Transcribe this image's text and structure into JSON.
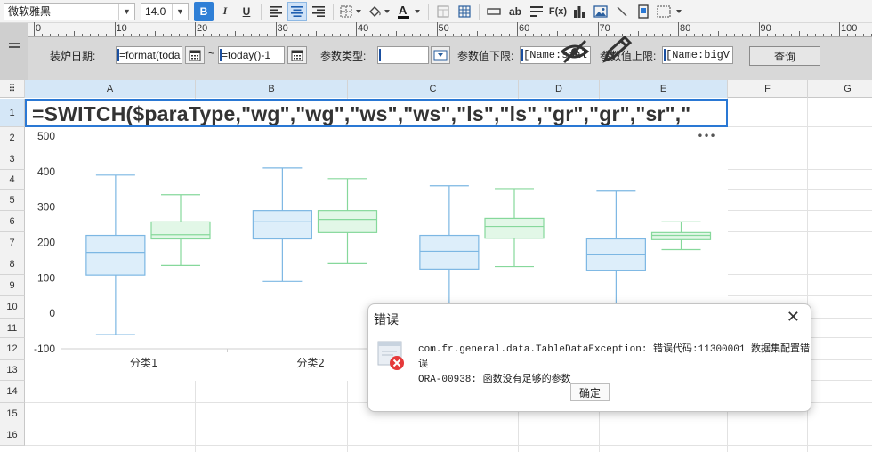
{
  "toolbar": {
    "font_name": "微软雅黑",
    "font_size": "14.0",
    "bold": "B",
    "italic": "I",
    "underline": "U",
    "fx": "F(x)",
    "ab": "ab"
  },
  "ruler": {
    "ticks": [
      "0",
      "10",
      "20",
      "30",
      "40",
      "50",
      "60",
      "70",
      "80",
      "90",
      "100"
    ]
  },
  "params": {
    "furnace_date_label": "装炉日期:",
    "date_from": "=format(toda",
    "tilde": "~",
    "date_to": "=today()-1",
    "param_type_label": "参数类型:",
    "param_type_value": "",
    "lower_label": "参数值下限:",
    "lower_value": "[Name:smal",
    "upper_label": "参数值上限:",
    "upper_value": "[Name:bigV",
    "query_button": "查询"
  },
  "grid": {
    "columns": [
      "A",
      "B",
      "C",
      "D",
      "E",
      "F",
      "G"
    ],
    "rows": [
      "1",
      "2",
      "3",
      "4",
      "5",
      "6",
      "7",
      "8",
      "9",
      "10",
      "11",
      "12",
      "13",
      "14",
      "15",
      "16"
    ],
    "formula_text": "=SWITCH($paraType,\"wg\",\"wg\",\"ws\",\"ws\",\"ls\",\"ls\",\"gr\",\"gr\",\"sr\",\""
  },
  "chart_data": {
    "type": "boxplot",
    "categories": [
      "分类1",
      "分类2",
      "",
      ""
    ],
    "ylim": [
      -100,
      500
    ],
    "yticks": [
      "500",
      "400",
      "300",
      "200",
      "100",
      "0",
      "-100"
    ],
    "series": [
      {
        "color": "#7cb7e3",
        "fill": "#ddeefa",
        "boxes": [
          {
            "min": -60,
            "q1": 108,
            "median": 172,
            "q3": 220,
            "max": 390
          },
          {
            "min": 90,
            "q1": 210,
            "median": 258,
            "q3": 290,
            "max": 410
          },
          {
            "min": -60,
            "q1": 125,
            "median": 175,
            "q3": 220,
            "max": 360
          },
          {
            "min": -60,
            "q1": 120,
            "median": 165,
            "q3": 210,
            "max": 345
          }
        ]
      },
      {
        "color": "#86d89b",
        "fill": "#e2f7e7",
        "boxes": [
          {
            "min": 135,
            "q1": 210,
            "median": 222,
            "q3": 258,
            "max": 335
          },
          {
            "min": 140,
            "q1": 228,
            "median": 265,
            "q3": 290,
            "max": 380
          },
          {
            "min": 132,
            "q1": 212,
            "median": 245,
            "q3": 268,
            "max": 352
          },
          {
            "min": 180,
            "q1": 208,
            "median": 220,
            "q3": 228,
            "max": 258
          }
        ]
      }
    ],
    "more_menu": "•••"
  },
  "dialog": {
    "title": "错误",
    "close": "✕",
    "line1": "com.fr.general.data.TableDataException: 错误代码:11300001 数据集配置错误",
    "line2": "ORA-00938: 函数没有足够的参数",
    "ok": "确定"
  }
}
